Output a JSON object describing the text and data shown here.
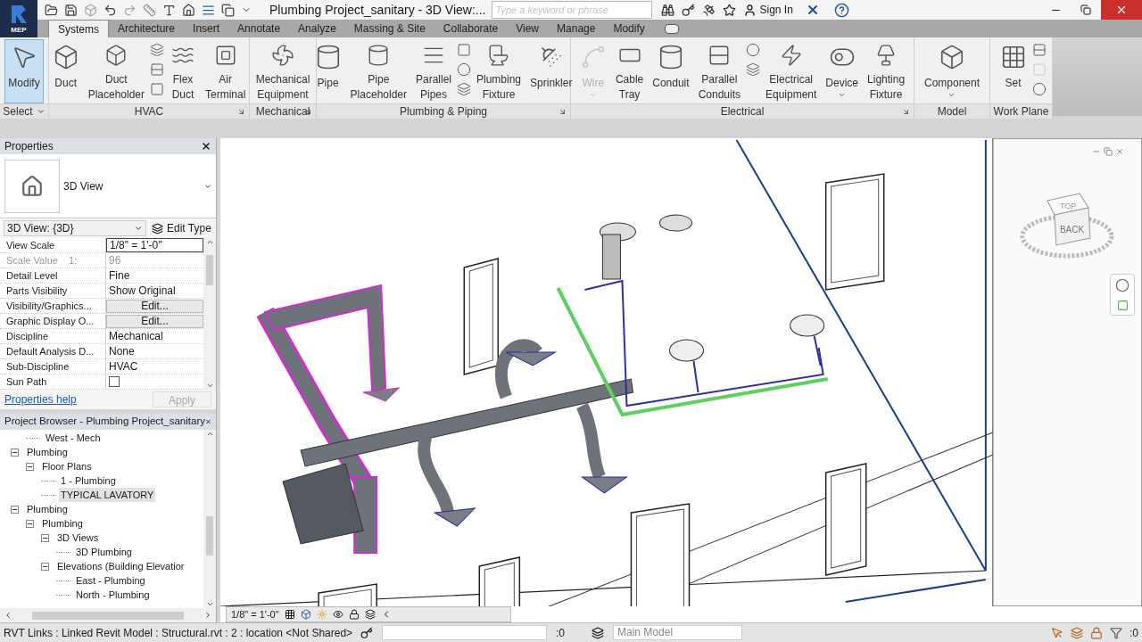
{
  "app_button": {
    "label": "MEP"
  },
  "window": {
    "title": "Plumbing Project_sanitary - 3D View:..."
  },
  "search": {
    "placeholder": "Type a keyword or phrase"
  },
  "account": {
    "label": "Sign In"
  },
  "tabs": [
    {
      "label": "Systems",
      "selected": true
    },
    {
      "label": "Architecture",
      "selected": false
    },
    {
      "label": "Insert",
      "selected": false
    },
    {
      "label": "Annotate",
      "selected": false
    },
    {
      "label": "Analyze",
      "selected": false
    },
    {
      "label": "Massing & Site",
      "selected": false
    },
    {
      "label": "Collaborate",
      "selected": false
    },
    {
      "label": "View",
      "selected": false
    },
    {
      "label": "Manage",
      "selected": false
    },
    {
      "label": "Modify",
      "selected": false
    }
  ],
  "ribbon_panels": [
    {
      "title": "Select",
      "kind": "dropdown",
      "tools": [
        {
          "kind": "large",
          "label": "Modify",
          "selected": true,
          "disabled": false,
          "dropdown": false
        }
      ]
    },
    {
      "title": "HVAC",
      "kind": "launcher",
      "tools": [
        {
          "kind": "large",
          "label": "Duct",
          "selected": false,
          "disabled": false,
          "dropdown": false
        },
        {
          "kind": "large",
          "label": "Duct Placeholder",
          "selected": false,
          "disabled": false,
          "dropdown": false
        },
        {
          "kind": "stack",
          "small_tools": [
            {
              "disabled": false
            },
            {
              "disabled": false
            },
            {
              "disabled": false
            }
          ]
        },
        {
          "kind": "large",
          "label": "Flex Duct",
          "selected": false,
          "disabled": false,
          "dropdown": false
        },
        {
          "kind": "large",
          "label": "Air Terminal",
          "selected": false,
          "disabled": false,
          "dropdown": false
        }
      ]
    },
    {
      "title": "Mechanical",
      "kind": "launcher",
      "tools": [
        {
          "kind": "large",
          "label": "Mechanical Equipment",
          "selected": false,
          "disabled": false,
          "dropdown": false
        }
      ]
    },
    {
      "title": "Plumbing & Piping",
      "kind": "launcher",
      "tools": [
        {
          "kind": "large",
          "label": "Pipe",
          "selected": false,
          "disabled": false,
          "dropdown": false
        },
        {
          "kind": "large",
          "label": "Pipe Placeholder",
          "selected": false,
          "disabled": false,
          "dropdown": false
        },
        {
          "kind": "large",
          "label": "Parallel Pipes",
          "selected": false,
          "disabled": false,
          "dropdown": false
        },
        {
          "kind": "stack",
          "small_tools": [
            {
              "disabled": false
            },
            {
              "disabled": false
            },
            {
              "disabled": false
            }
          ]
        },
        {
          "kind": "large",
          "label": "Plumbing Fixture",
          "selected": false,
          "disabled": false,
          "dropdown": false
        },
        {
          "kind": "large",
          "label": "Sprinkler",
          "selected": false,
          "disabled": false,
          "dropdown": false
        }
      ]
    },
    {
      "title": "Electrical",
      "kind": "launcher",
      "tools": [
        {
          "kind": "large",
          "label": "Wire",
          "selected": false,
          "disabled": true,
          "dropdown": true
        },
        {
          "kind": "large",
          "label": "Cable Tray",
          "selected": false,
          "disabled": false,
          "dropdown": false
        },
        {
          "kind": "large",
          "label": "Conduit",
          "selected": false,
          "disabled": false,
          "dropdown": false
        },
        {
          "kind": "large",
          "label": "Parallel Conduits",
          "selected": false,
          "disabled": false,
          "dropdown": false
        },
        {
          "kind": "stack",
          "small_tools": [
            {
              "disabled": false
            },
            {
              "disabled": false
            }
          ]
        },
        {
          "kind": "large",
          "label": "Electrical Equipment",
          "selected": false,
          "disabled": false,
          "dropdown": false
        },
        {
          "kind": "large",
          "label": "Device",
          "selected": false,
          "disabled": false,
          "dropdown": true
        },
        {
          "kind": "large",
          "label": "Lighting Fixture",
          "selected": false,
          "disabled": false,
          "dropdown": false
        }
      ]
    },
    {
      "title": "Model",
      "kind": "plain",
      "tools": [
        {
          "kind": "large",
          "label": "Component",
          "selected": false,
          "disabled": false,
          "dropdown": true
        }
      ]
    },
    {
      "title": "Work Plane",
      "kind": "plain",
      "tools": [
        {
          "kind": "large",
          "label": "Set",
          "selected": false,
          "disabled": false,
          "dropdown": false
        },
        {
          "kind": "stack",
          "small_tools": [
            {
              "disabled": false
            },
            {
              "disabled": true
            },
            {
              "disabled": false
            }
          ]
        }
      ]
    }
  ],
  "properties": {
    "title": "Properties",
    "type_name": "3D View",
    "instance": "3D View: {3D}",
    "edit_type": "Edit Type",
    "rows": [
      {
        "name": "View Scale",
        "kind": "input",
        "value": "1/8\" = 1'-0\"",
        "disabled": false
      },
      {
        "name": "Scale Value    1:",
        "kind": "text",
        "value": "96",
        "disabled": true
      },
      {
        "name": "Detail Level",
        "kind": "text",
        "value": "Fine",
        "disabled": false
      },
      {
        "name": "Parts Visibility",
        "kind": "text",
        "value": "Show Original",
        "disabled": false
      },
      {
        "name": "Visibility/Graphics...",
        "kind": "button",
        "value": "Edit...",
        "disabled": false
      },
      {
        "name": "Graphic Display O...",
        "kind": "button",
        "value": "Edit...",
        "disabled": false
      },
      {
        "name": "Discipline",
        "kind": "text",
        "value": "Mechanical",
        "disabled": false
      },
      {
        "name": "Default Analysis D...",
        "kind": "text",
        "value": "None",
        "disabled": false
      },
      {
        "name": "Sub-Discipline",
        "kind": "text",
        "value": "HVAC",
        "disabled": false
      },
      {
        "name": "Sun Path",
        "kind": "checkbox",
        "checked": false,
        "disabled": false
      }
    ],
    "help_link": "Properties help",
    "apply": {
      "label": "Apply",
      "disabled": true
    }
  },
  "project_browser": {
    "title": "Project Browser - Plumbing Project_sanitary",
    "tree": [
      {
        "children": [
          {
            "children": [
              {
                "label": "West - Mech",
                "selected": false
              }
            ]
          },
          {
            "label": "Plumbing",
            "expanded": true,
            "selected": false,
            "children": [
              {
                "label": "Floor Plans",
                "expanded": true,
                "selected": false,
                "children": [
                  {
                    "label": "1 - Plumbing",
                    "selected": false
                  },
                  {
                    "label": "TYPICAL LAVATORY",
                    "selected": true
                  }
                ]
              }
            ]
          }
        ]
      },
      {
        "label": "Plumbing",
        "expanded": true,
        "selected": false,
        "children": [
          {
            "label": "Plumbing",
            "expanded": true,
            "selected": false,
            "children": [
              {
                "label": "3D Views",
                "expanded": true,
                "selected": false,
                "children": [
                  {
                    "label": "3D Plumbing",
                    "selected": false
                  }
                ]
              },
              {
                "label": "Elevations (Building Elevatior",
                "expanded": true,
                "selected": false,
                "children": [
                  {
                    "label": "East - Plumbing",
                    "selected": false
                  },
                  {
                    "label": "North - Plumbing",
                    "selected": false
                  }
                ]
              }
            ]
          }
        ]
      }
    ]
  },
  "viewport": {
    "viewcube_top": "TOP",
    "viewcube_face": "BACK",
    "scale": "1/8\" = 1'-0\""
  },
  "status_bar": {
    "message": "RVT Links : Linked Revit Model : Structural.rvt : 2 : location <Not Shared>",
    "worksets_count": ":0",
    "model": "Main Model",
    "filter_count": ":0"
  }
}
